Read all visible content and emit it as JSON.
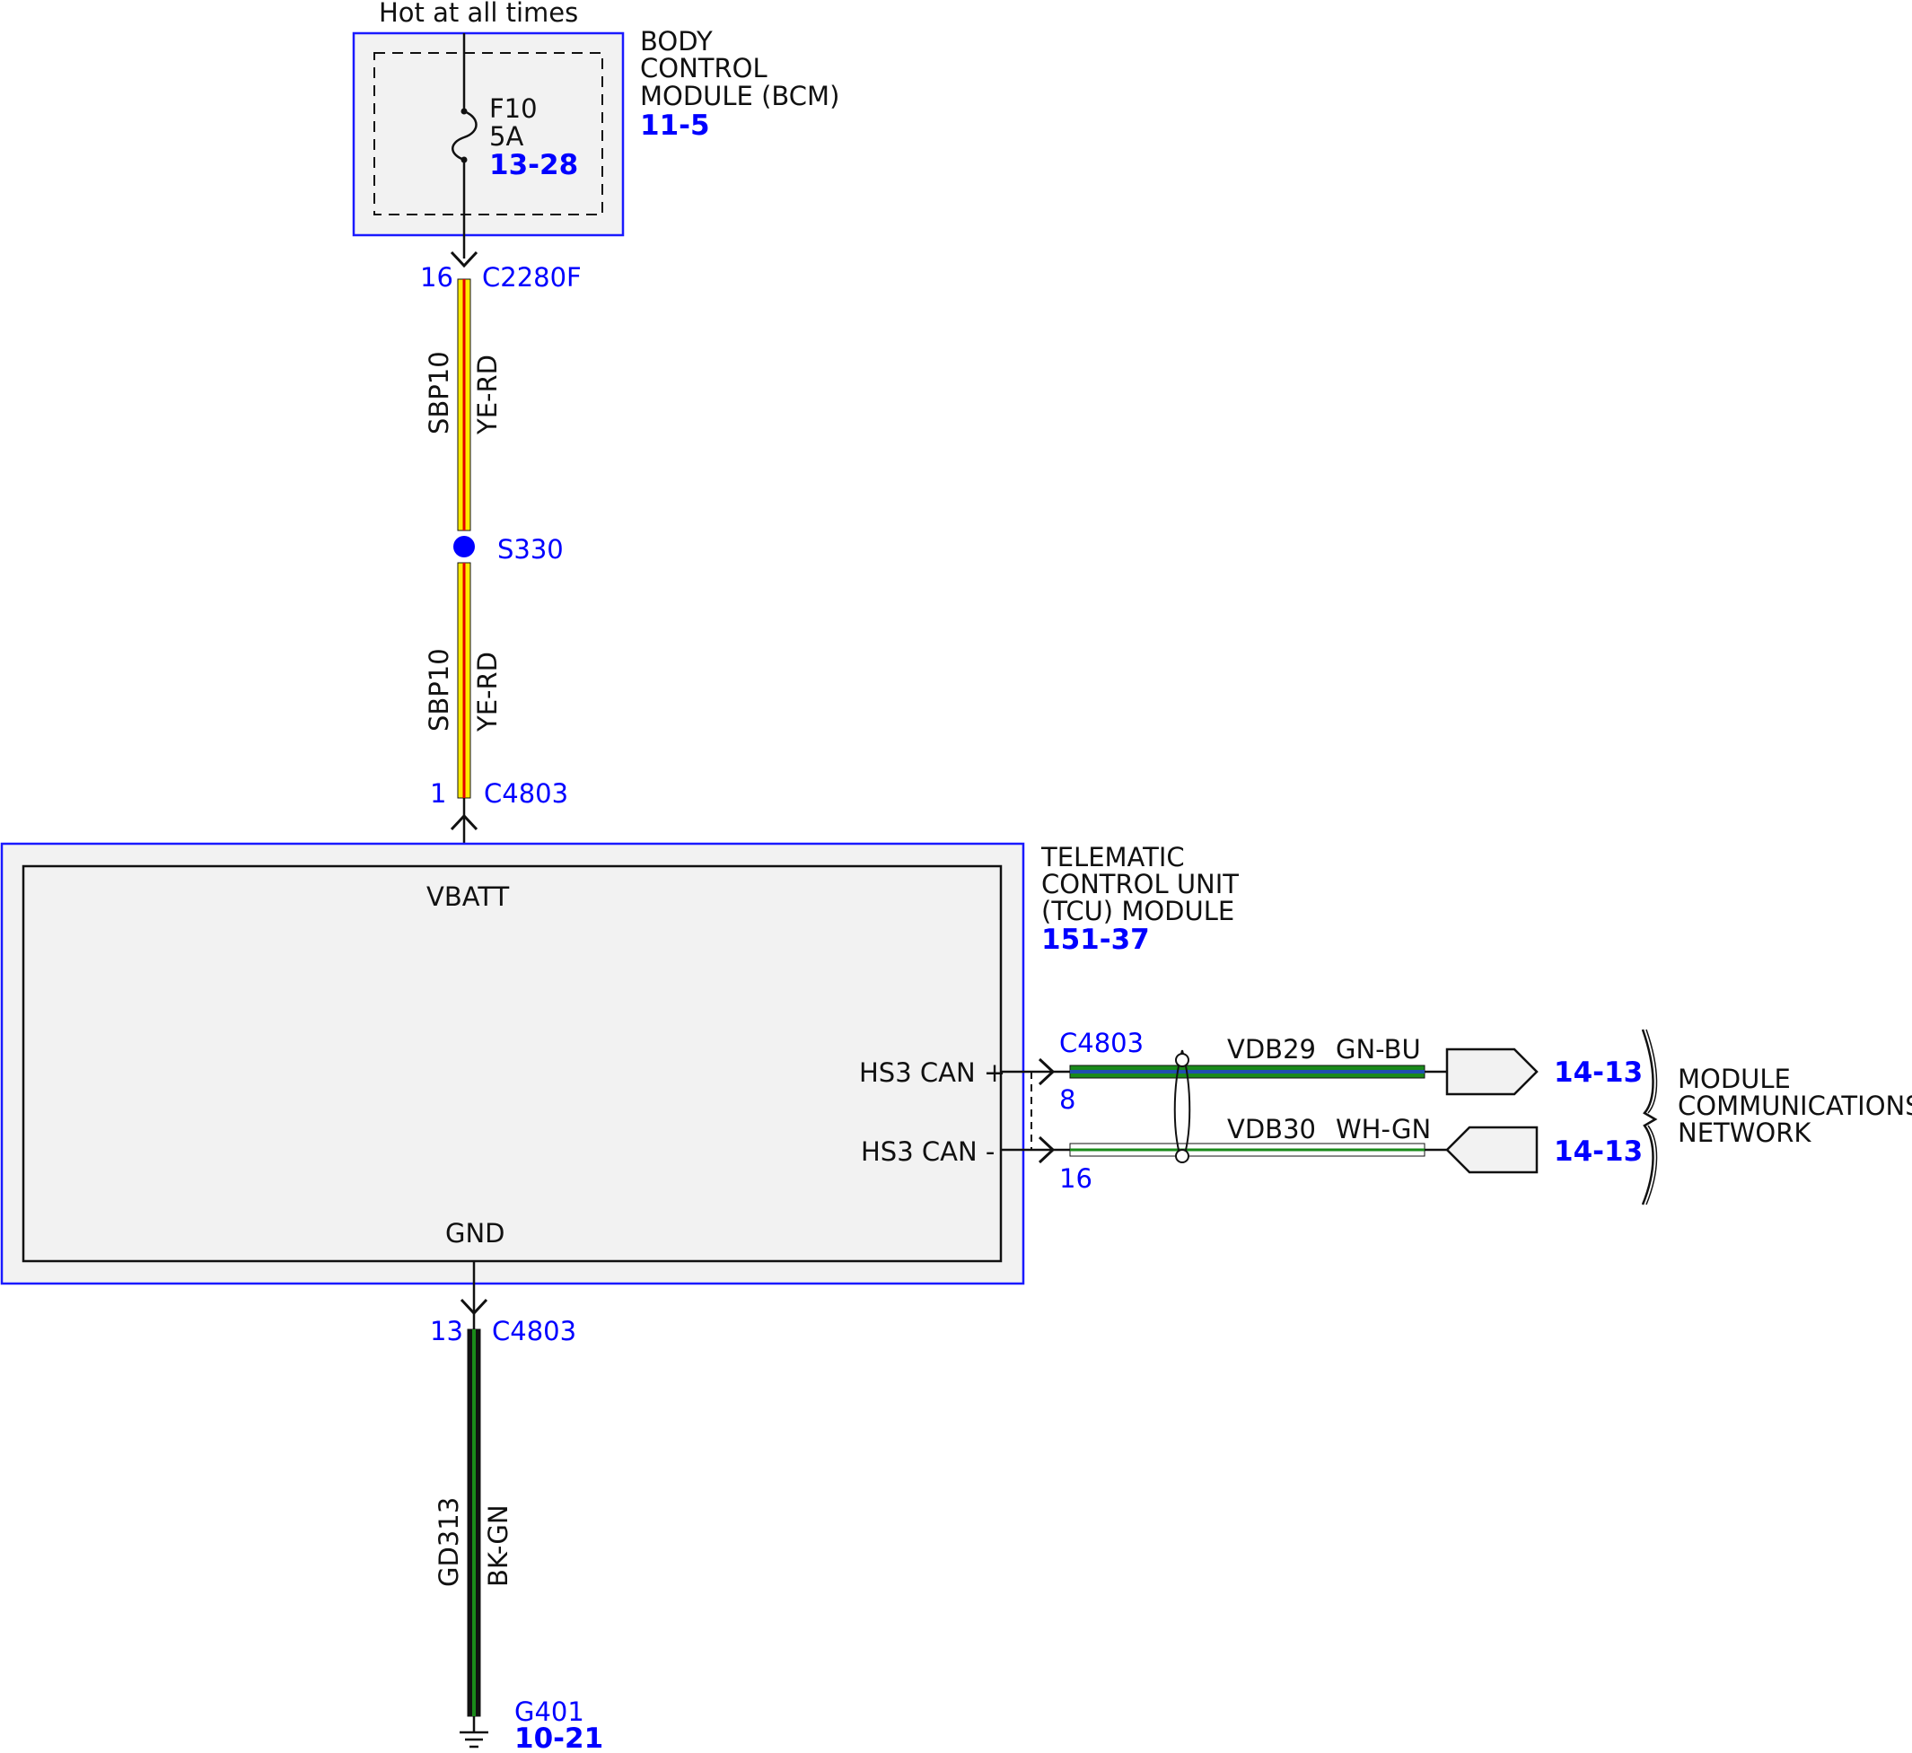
{
  "colors": {
    "module_border": "#1a1aff",
    "module_fill": "#f2f2f2",
    "wire_black": "#111111",
    "ref_blue": "#0000ff",
    "yellow": "#ffea00",
    "red": "#e30000",
    "green": "#1a8a1a",
    "dark_green": "#0f5f0f",
    "blue": "#1f4fb0",
    "splice": "#0000ff"
  },
  "power": {
    "label": "Hot at all times"
  },
  "bcm": {
    "name_line1": "BODY",
    "name_line2": "CONTROL",
    "name_line3": "MODULE (BCM)",
    "ref": "11-5",
    "fuse": {
      "id": "F10",
      "rating": "5A",
      "ref": "13-28"
    }
  },
  "connector_c2280f": {
    "pin": "16",
    "id": "C2280F"
  },
  "wire_upper": {
    "circuit": "SBP10",
    "color": "YE-RD"
  },
  "splice": {
    "id": "S330"
  },
  "wire_lower": {
    "circuit": "SBP10",
    "color": "YE-RD"
  },
  "connector_c4803_vbatt": {
    "pin": "1",
    "id": "C4803"
  },
  "tcu": {
    "name_line1": "TELEMATIC",
    "name_line2": "CONTROL UNIT",
    "name_line3": "(TCU) MODULE",
    "ref": "151-37",
    "vbatt_label": "VBATT",
    "gnd_label": "GND",
    "can_plus_label": "HS3 CAN +",
    "can_minus_label": "HS3 CAN -"
  },
  "can_connector": {
    "id": "C4803",
    "pin_plus": "8",
    "pin_minus": "16"
  },
  "can_plus_wire": {
    "circuit": "VDB29",
    "color": "GN-BU",
    "ref": "14-13"
  },
  "can_minus_wire": {
    "circuit": "VDB30",
    "color": "WH-GN",
    "ref": "14-13"
  },
  "network": {
    "line1": "MODULE",
    "line2": "COMMUNICATIONS",
    "line3": "NETWORK"
  },
  "connector_c4803_gnd": {
    "pin": "13",
    "id": "C4803"
  },
  "ground_wire": {
    "circuit": "GD313",
    "color": "BK-GN"
  },
  "ground": {
    "id": "G401",
    "ref": "10-21"
  }
}
